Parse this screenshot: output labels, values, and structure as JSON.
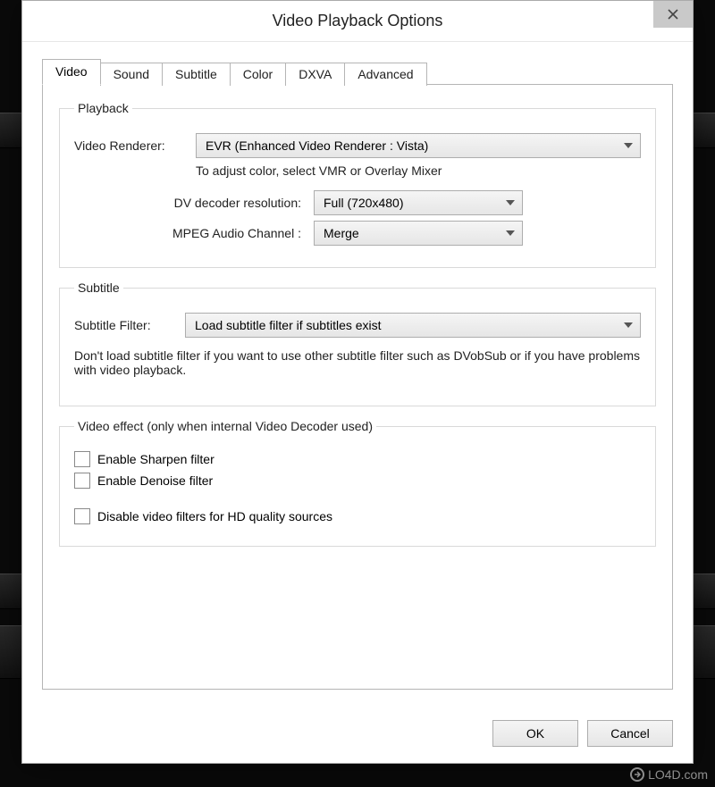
{
  "window": {
    "title": "Video Playback Options"
  },
  "tabs": [
    {
      "label": "Video",
      "active": true
    },
    {
      "label": "Sound",
      "active": false
    },
    {
      "label": "Subtitle",
      "active": false
    },
    {
      "label": "Color",
      "active": false
    },
    {
      "label": "DXVA",
      "active": false
    },
    {
      "label": "Advanced",
      "active": false
    }
  ],
  "playback": {
    "legend": "Playback",
    "renderer_label": "Video Renderer:",
    "renderer_value": "EVR (Enhanced Video Renderer : Vista)",
    "renderer_hint": "To adjust color, select VMR or Overlay Mixer",
    "dv_label": "DV decoder resolution:",
    "dv_value": "Full (720x480)",
    "mpeg_label": "MPEG Audio Channel :",
    "mpeg_value": "Merge"
  },
  "subtitle": {
    "legend": "Subtitle",
    "filter_label": "Subtitle Filter:",
    "filter_value": "Load subtitle filter if subtitles exist",
    "note": "Don't load subtitle filter if you want to use other subtitle filter such as DVobSub or if you have problems with video playback."
  },
  "effect": {
    "legend": "Video effect (only when internal Video Decoder used)",
    "sharpen_label": "Enable Sharpen filter",
    "sharpen_checked": false,
    "denoise_label": "Enable Denoise filter",
    "denoise_checked": false,
    "disablehd_label": "Disable video filters for HD quality sources",
    "disablehd_checked": false
  },
  "buttons": {
    "ok": "OK",
    "cancel": "Cancel"
  },
  "watermark": "LO4D.com"
}
